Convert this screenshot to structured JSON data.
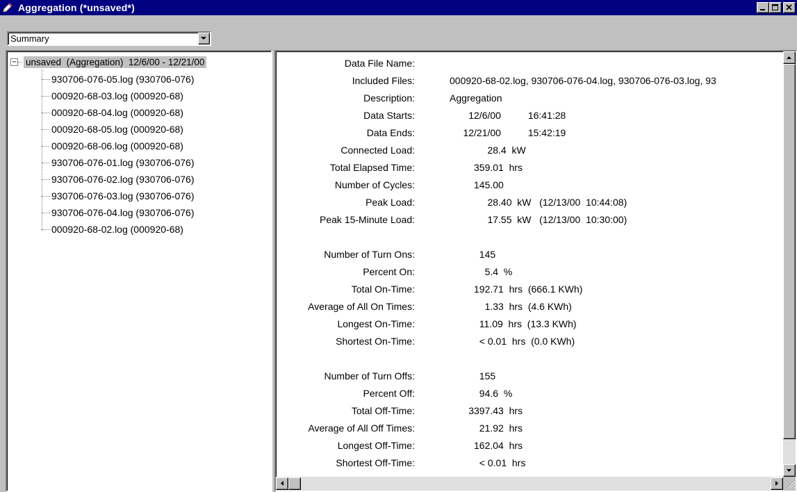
{
  "window": {
    "title": "Aggregation (*unsaved*)",
    "title_icon": "pencil-icon",
    "colors": {
      "titlebar": "#000080",
      "face": "#c0c0c0"
    }
  },
  "toolbar": {
    "view_select": {
      "selected": "Summary"
    }
  },
  "tree": {
    "expander": "−",
    "root_label": "unsaved  (Aggregation)  12/6/00 - 12/21/00",
    "items": [
      "930706-076-05.log (930706-076)",
      "000920-68-03.log (000920-68)",
      "000920-68-04.log (000920-68)",
      "000920-68-05.log (000920-68)",
      "000920-68-06.log (000920-68)",
      "930706-076-01.log (930706-076)",
      "930706-076-02.log (930706-076)",
      "930706-076-03.log (930706-076)",
      "930706-076-04.log (930706-076)",
      "000920-68-02.log (000920-68)"
    ]
  },
  "summary": {
    "rows": [
      {
        "label": "Data File Name:",
        "value": ""
      },
      {
        "label": "Included Files:",
        "value": "000920-68-02.log, 930706-076-04.log, 930706-076-03.log, 93"
      },
      {
        "label": "Description:",
        "value": "Aggregation"
      },
      {
        "label": "Data Starts:",
        "value": "       12/6/00          16:41:28"
      },
      {
        "label": "Data Ends:",
        "value": "     12/21/00          15:42:19"
      },
      {
        "label": "Connected Load:",
        "value": "              28.4  kW"
      },
      {
        "label": "Total Elapsed Time:",
        "value": "         359.01  hrs"
      },
      {
        "label": "Number of Cycles:",
        "value": "         145.00"
      },
      {
        "label": "Peak Load:",
        "value": "              28.40  kW   (12/13/00  10:44:08)"
      },
      {
        "label": "Peak 15-Minute Load:",
        "value": "              17.55  kW   (12/13/00  10:30:00)"
      },
      {
        "label": "",
        "value": ""
      },
      {
        "label": "Number of Turn Ons:",
        "value": "           145"
      },
      {
        "label": "Percent On:",
        "value": "             5.4  %"
      },
      {
        "label": "Total On-Time:",
        "value": "         192.71  hrs  (666.1 KWh)"
      },
      {
        "label": "Average of All On Times:",
        "value": "             1.33  hrs  (4.6 KWh)"
      },
      {
        "label": "Longest On-Time:",
        "value": "           11.09  hrs  (13.3 KWh)"
      },
      {
        "label": "Shortest On-Time:",
        "value": "           < 0.01  hrs  (0.0 KWh)"
      },
      {
        "label": "",
        "value": ""
      },
      {
        "label": "Number of Turn Offs:",
        "value": "           155"
      },
      {
        "label": "Percent Off:",
        "value": "           94.6  %"
      },
      {
        "label": "Total Off-Time:",
        "value": "       3397.43  hrs"
      },
      {
        "label": "Average of All Off Times:",
        "value": "           21.92  hrs"
      },
      {
        "label": "Longest Off-Time:",
        "value": "         162.04  hrs"
      },
      {
        "label": "Shortest Off-Time:",
        "value": "           < 0.01  hrs"
      }
    ]
  }
}
